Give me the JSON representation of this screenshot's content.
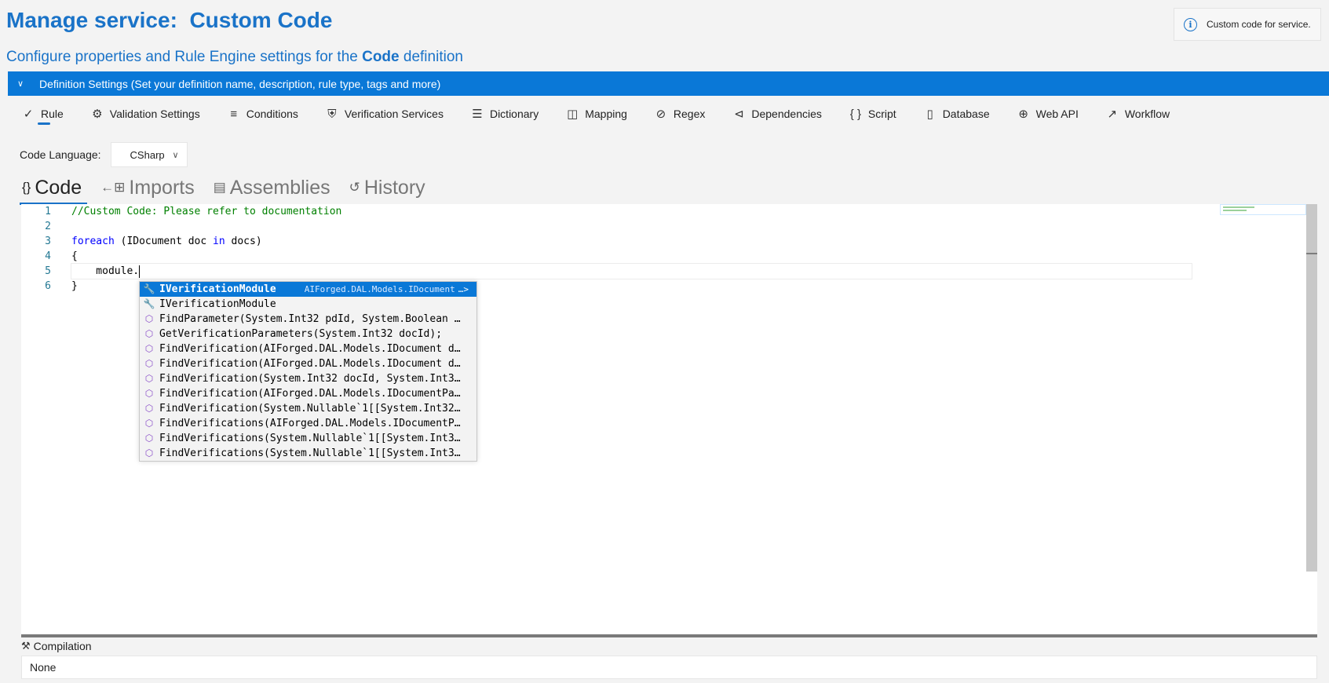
{
  "header": {
    "title_prefix": "Manage service:",
    "title_name": "Custom Code",
    "subtitle_before": "Configure properties and Rule Engine settings for the",
    "subtitle_bold": "Code",
    "subtitle_after": "definition"
  },
  "info": {
    "text": "Custom code for service."
  },
  "definition_bar": {
    "label": "Definition Settings (Set your definition name, description, rule type, tags and more)"
  },
  "toolbar": {
    "items": [
      {
        "label": "Rule",
        "icon": "check-icon"
      },
      {
        "label": "Validation Settings",
        "icon": "validation-icon"
      },
      {
        "label": "Conditions",
        "icon": "conditions-list-icon"
      },
      {
        "label": "Verification Services",
        "icon": "shield-icon"
      },
      {
        "label": "Dictionary",
        "icon": "dictionary-list-icon"
      },
      {
        "label": "Mapping",
        "icon": "book-icon"
      },
      {
        "label": "Regex",
        "icon": "regex-icon"
      },
      {
        "label": "Dependencies",
        "icon": "share-nodes-icon"
      },
      {
        "label": "Script",
        "icon": "braces-icon"
      },
      {
        "label": "Database",
        "icon": "database-icon"
      },
      {
        "label": "Web API",
        "icon": "web-api-icon"
      },
      {
        "label": "Workflow",
        "icon": "workflow-icon"
      }
    ]
  },
  "code_language": {
    "label": "Code Language:",
    "value": "CSharp"
  },
  "code_tabs": [
    {
      "label": "Code",
      "icon": "braces-icon"
    },
    {
      "label": "Imports",
      "icon": "imports-icon"
    },
    {
      "label": "Assemblies",
      "icon": "assemblies-icon"
    },
    {
      "label": "History",
      "icon": "history-icon"
    }
  ],
  "editor": {
    "line_numbers": [
      "1",
      "2",
      "3",
      "4",
      "5",
      "6"
    ],
    "comment": "//Custom Code: Please refer to documentation",
    "kw_foreach": "foreach",
    "loop_mid": " (IDocument doc ",
    "kw_in": "in",
    "loop_end": " docs)",
    "open_brace": "{",
    "line5": "    module.",
    "close_brace": "}"
  },
  "suggestions": {
    "selected": {
      "label": "IVerificationModule",
      "detail": "AIForged.DAL.Models.IDocument",
      "more": "…>"
    },
    "items": [
      {
        "label": "IVerificationModule",
        "kind": "wrench-icon"
      },
      {
        "label": "FindParameter(System.Int32 pdId, System.Boolean i…",
        "kind": "method-cube-icon"
      },
      {
        "label": "GetVerificationParameters(System.Int32 docId);",
        "kind": "method-cube-icon"
      },
      {
        "label": "FindVerification(AIForged.DAL.Models.IDocument do…",
        "kind": "method-cube-icon"
      },
      {
        "label": "FindVerification(AIForged.DAL.Models.IDocument do…",
        "kind": "method-cube-icon"
      },
      {
        "label": "FindVerification(System.Int32 docId, System.Int32…",
        "kind": "method-cube-icon"
      },
      {
        "label": "FindVerification(AIForged.DAL.Models.IDocumentPar…",
        "kind": "method-cube-icon"
      },
      {
        "label": "FindVerification(System.Nullable`1[[System.Int32,…",
        "kind": "method-cube-icon"
      },
      {
        "label": "FindVerifications(AIForged.DAL.Models.IDocumentPa…",
        "kind": "method-cube-icon"
      },
      {
        "label": "FindVerifications(System.Nullable`1[[System.Int32…",
        "kind": "method-cube-icon"
      },
      {
        "label": "FindVerifications(System.Nullable`1[[System.Int32…",
        "kind": "method-cube-icon"
      }
    ]
  },
  "compilation": {
    "title": "Compilation",
    "result": "None"
  },
  "colors": {
    "accent": "#1a73c8",
    "bar": "#0a78d7",
    "comment": "#008000",
    "keyword": "#0000ff",
    "method_icon": "#8b4fc9"
  }
}
